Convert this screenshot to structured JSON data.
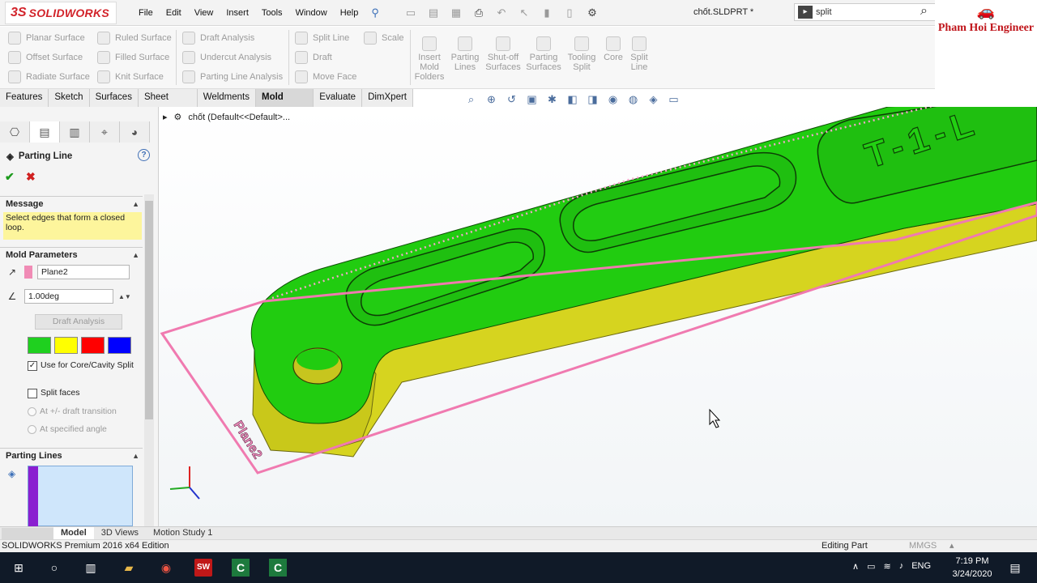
{
  "app": {
    "brand": "SOLIDWORKS",
    "document_title": "chốt.SLDPRT *",
    "menu": [
      "File",
      "Edit",
      "View",
      "Insert",
      "Tools",
      "Window",
      "Help"
    ],
    "search_value": "split",
    "watermark": "Pham Hoi Engineer"
  },
  "ribbon": {
    "surfaces_col1": [
      "Planar Surface",
      "Offset Surface",
      "Radiate Surface"
    ],
    "surfaces_col2": [
      "Ruled Surface",
      "Filled Surface",
      "Knit Surface"
    ],
    "analysis_col": [
      "Draft Analysis",
      "Undercut Analysis",
      "Parting Line Analysis"
    ],
    "face_col": [
      "Split Line",
      "Draft",
      "Move Face"
    ],
    "scale": "Scale",
    "mold_tools": [
      {
        "label": "Insert\nMold\nFolders"
      },
      {
        "label": "Parting\nLines"
      },
      {
        "label": "Shut-off\nSurfaces"
      },
      {
        "label": "Parting\nSurfaces"
      },
      {
        "label": "Tooling\nSplit"
      },
      {
        "label": "Core"
      },
      {
        "label": "Split\nLine"
      }
    ]
  },
  "tabs": [
    "Features",
    "Sketch",
    "Surfaces",
    "Sheet Metal",
    "Weldments",
    "Mold Tools",
    "Evaluate",
    "DimXpert"
  ],
  "active_tab": "Mold Tools",
  "feature_tree": {
    "part_name": "chốt  (Default<<Default>..."
  },
  "property_manager": {
    "title": "Parting Line",
    "message_header": "Message",
    "message_text": "Select edges that form a closed loop.",
    "mold_params_header": "Mold Parameters",
    "direction_value": "Plane2",
    "angle_value": "1.00deg",
    "draft_analysis_button": "Draft Analysis",
    "color_swatches": [
      "#1fd01f",
      "#ffff00",
      "#ff0000",
      "#0000ff"
    ],
    "use_core_cavity_label": "Use for Core/Cavity Split",
    "use_core_cavity_checked": true,
    "split_faces_label": "Split faces",
    "split_faces_checked": false,
    "radio_draft_transition": "At +/- draft transition",
    "radio_specified_angle": "At specified angle",
    "parting_lines_header": "Parting Lines"
  },
  "viewport": {
    "plane_label": "Plane2",
    "engraved_text": "T-1-L",
    "part_top_color": "#1fcf10",
    "part_side_color": "#d8d820",
    "plane_color": "#f07ab0"
  },
  "bottom_tabs": [
    "Model",
    "3D Views",
    "Motion Study 1"
  ],
  "active_bottom_tab": "Model",
  "status": {
    "edition": "SOLIDWORKS Premium 2016 x64 Edition",
    "mode": "Editing Part",
    "units": "MMGS"
  },
  "taskbar": {
    "language": "ENG",
    "time": "7:19 PM",
    "date": "3/24/2020"
  }
}
